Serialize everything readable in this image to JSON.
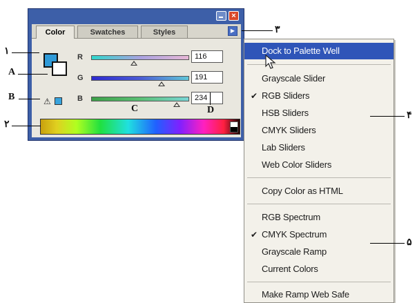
{
  "palette": {
    "tabs": [
      "Color",
      "Swatches",
      "Styles"
    ],
    "close_glyph": "×",
    "menu_arrow_icon": "triangle-right-icon",
    "sliders": [
      {
        "label": "R",
        "value": "116"
      },
      {
        "label": "G",
        "value": "191"
      },
      {
        "label": "B",
        "value": "234"
      }
    ],
    "warning_icon": "⚠",
    "colors": {
      "foreground": "#2f9ad8",
      "background": "#ffffff",
      "websafe": "#38a3dd",
      "title": "#3d5fa8"
    }
  },
  "menu": {
    "items": [
      {
        "label": "Dock to Palette Well",
        "highlighted": true
      },
      {
        "label": "Grayscale Slider"
      },
      {
        "label": "RGB Sliders",
        "checked": true
      },
      {
        "label": "HSB Sliders"
      },
      {
        "label": "CMYK Sliders"
      },
      {
        "label": "Lab Sliders"
      },
      {
        "label": "Web Color Sliders"
      },
      {
        "label": "Copy Color as HTML"
      },
      {
        "label": "RGB Spectrum"
      },
      {
        "label": "CMYK Spectrum",
        "checked": true
      },
      {
        "label": "Grayscale Ramp"
      },
      {
        "label": "Current Colors"
      },
      {
        "label": "Make Ramp Web Safe"
      }
    ],
    "check_glyph": "✔",
    "highlight_color": "#2f55b8"
  },
  "annotations": {
    "one": "۱",
    "two": "۲",
    "three": "۳",
    "four": "۴",
    "five": "۵",
    "A": "A",
    "B": "B",
    "C": "C",
    "D": "D"
  }
}
